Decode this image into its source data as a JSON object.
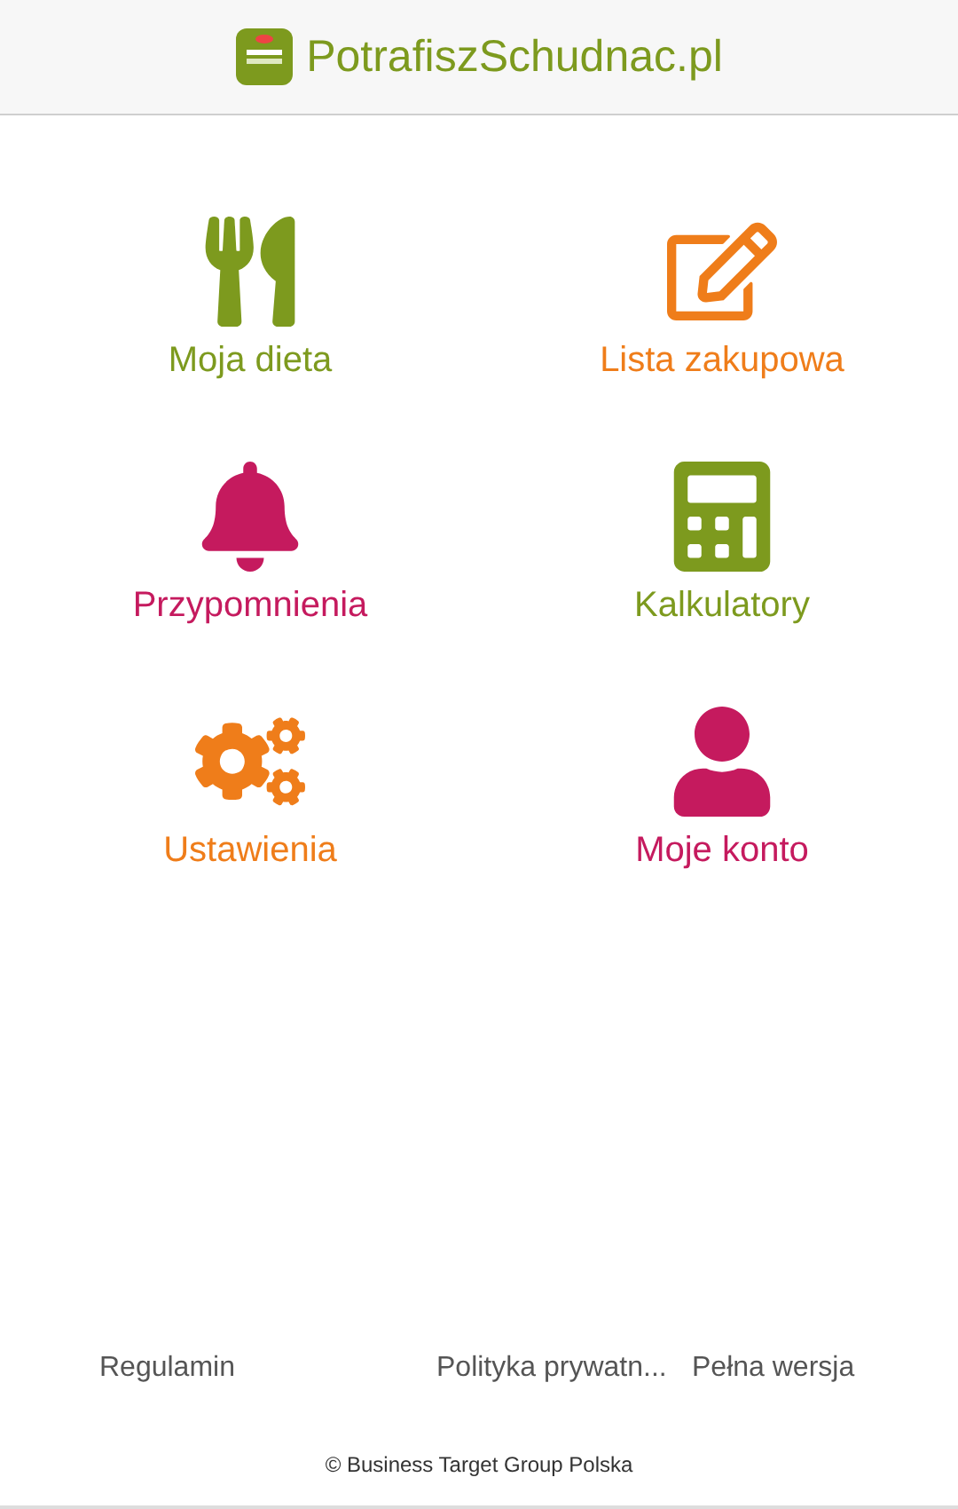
{
  "header": {
    "title": "PotrafiszSchudnac.pl"
  },
  "menu": [
    {
      "label": "Moja dieta",
      "kind": "utensils",
      "color": "#7d9a1e"
    },
    {
      "label": "Lista zakupowa",
      "kind": "edit",
      "color": "#ef7d1a"
    },
    {
      "label": "Przypomnienia",
      "kind": "bell",
      "color": "#c51a5e"
    },
    {
      "label": "Kalkulatory",
      "kind": "calculator",
      "color": "#7d9a1e"
    },
    {
      "label": "Ustawienia",
      "kind": "gears",
      "color": "#ef7d1a"
    },
    {
      "label": "Moje konto",
      "kind": "user",
      "color": "#c51a5e"
    }
  ],
  "footer": {
    "links": [
      "Regulamin",
      "Polityka prywatn...",
      "Pełna wersja"
    ],
    "copyright": "© Business Target Group Polska"
  }
}
